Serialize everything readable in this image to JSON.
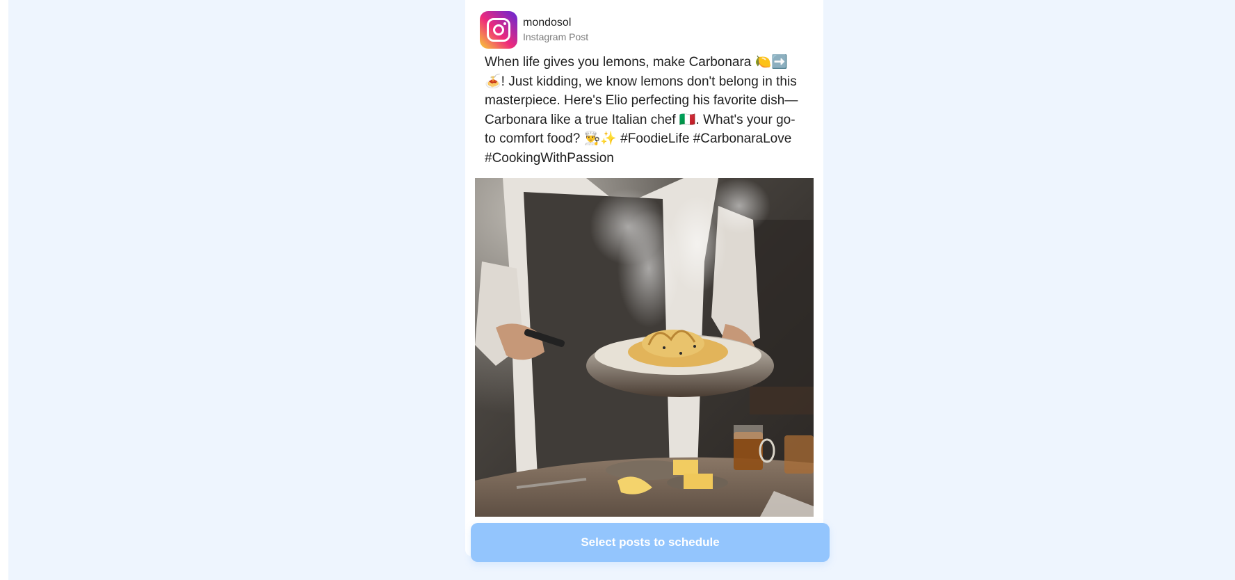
{
  "post": {
    "author": "mondosol",
    "platform_label": "Instagram Post",
    "caption": "When life gives you lemons, make Carbonara 🍋➡️🍝! Just kidding, we know lemons don't belong in this masterpiece. Here's Elio perfecting his favorite dish—Carbonara like a true Italian chef 🇮🇹. What's your go-to comfort food? 👨‍🍳✨ #FoodieLife #CarbonaraLove #CookingWithPassion",
    "image_icon": "photo-chef-carbonara"
  },
  "actions": {
    "schedule_label": "Select posts to schedule"
  },
  "colors": {
    "page_background": "#eef5fe",
    "card_background": "#ffffff",
    "button_disabled": "#93c5fd"
  }
}
